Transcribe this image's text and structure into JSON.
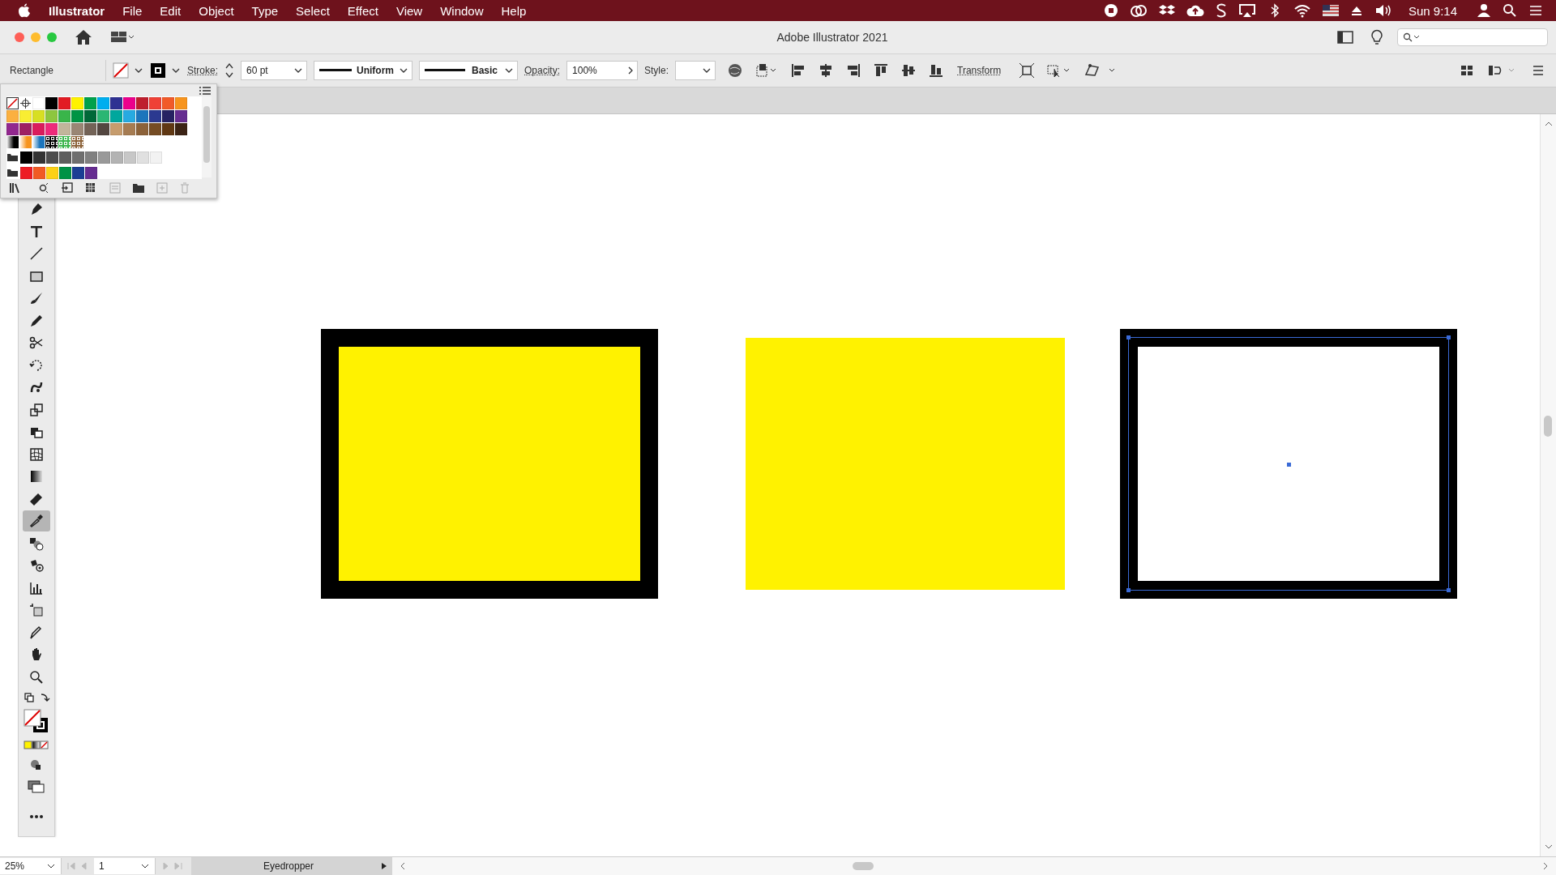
{
  "menu_bar": {
    "app_name": "Illustrator",
    "menus": [
      "File",
      "Edit",
      "Object",
      "Type",
      "Select",
      "Effect",
      "View",
      "Window",
      "Help"
    ],
    "clock": "Sun 9:14"
  },
  "window": {
    "title": "Adobe Illustrator 2021"
  },
  "control_bar": {
    "selection_label": "Rectangle",
    "stroke_label": "Stroke:",
    "stroke_weight": "60 pt",
    "stroke_profile": "Uniform",
    "brush": "Basic",
    "opacity_label": "Opacity:",
    "opacity": "100%",
    "style_label": "Style:",
    "transform": "Transform"
  },
  "swatches_panel": {
    "rows": [
      {
        "folder": false,
        "swatches": [
          {
            "kind": "none"
          },
          {
            "kind": "registration"
          },
          {
            "kind": "color",
            "color": "#ffffff"
          },
          {
            "kind": "color",
            "color": "#000000"
          },
          {
            "kind": "color",
            "color": "#e21b23"
          },
          {
            "kind": "color",
            "color": "#fff200"
          },
          {
            "kind": "color",
            "color": "#00a14b"
          },
          {
            "kind": "color",
            "color": "#00aeef"
          },
          {
            "kind": "color",
            "color": "#2e3192"
          },
          {
            "kind": "color",
            "color": "#ec008c"
          },
          {
            "kind": "color",
            "color": "#be1e2d"
          },
          {
            "kind": "color",
            "color": "#ef4136"
          },
          {
            "kind": "color",
            "color": "#f15a29"
          },
          {
            "kind": "color",
            "color": "#f7941d"
          }
        ]
      },
      {
        "folder": false,
        "swatches": [
          {
            "kind": "color",
            "color": "#fbb040"
          },
          {
            "kind": "color",
            "color": "#f9ed32"
          },
          {
            "kind": "color",
            "color": "#d7df23"
          },
          {
            "kind": "color",
            "color": "#8dc63f"
          },
          {
            "kind": "color",
            "color": "#39b54a"
          },
          {
            "kind": "color",
            "color": "#009444"
          },
          {
            "kind": "color",
            "color": "#006838"
          },
          {
            "kind": "color",
            "color": "#2bb673"
          },
          {
            "kind": "color",
            "color": "#00a79d"
          },
          {
            "kind": "color",
            "color": "#27aae1"
          },
          {
            "kind": "color",
            "color": "#1c75bc"
          },
          {
            "kind": "color",
            "color": "#2b3990"
          },
          {
            "kind": "color",
            "color": "#262262"
          },
          {
            "kind": "color",
            "color": "#662d91"
          }
        ]
      },
      {
        "folder": false,
        "swatches": [
          {
            "kind": "color",
            "color": "#92278f"
          },
          {
            "kind": "color",
            "color": "#9e1f63"
          },
          {
            "kind": "color",
            "color": "#da1c5c"
          },
          {
            "kind": "color",
            "color": "#ee2a7b"
          },
          {
            "kind": "color",
            "color": "#c2b59b"
          },
          {
            "kind": "color",
            "color": "#998675"
          },
          {
            "kind": "color",
            "color": "#736357"
          },
          {
            "kind": "color",
            "color": "#534741"
          },
          {
            "kind": "color",
            "color": "#c69c6d"
          },
          {
            "kind": "color",
            "color": "#a67c52"
          },
          {
            "kind": "color",
            "color": "#8c6239"
          },
          {
            "kind": "color",
            "color": "#754c24"
          },
          {
            "kind": "color",
            "color": "#603813"
          },
          {
            "kind": "color",
            "color": "#3c2415"
          }
        ]
      },
      {
        "folder": false,
        "swatches": [
          {
            "kind": "gradient",
            "color": "#000000"
          },
          {
            "kind": "gradient",
            "color": "#f7941d"
          },
          {
            "kind": "gradient",
            "color": "#1c75bc"
          },
          {
            "kind": "pattern",
            "color": "#000000"
          },
          {
            "kind": "pattern",
            "color": "#39b54a"
          },
          {
            "kind": "pattern",
            "color": "#8c6239"
          }
        ]
      },
      {
        "folder": true,
        "swatches": [
          {
            "kind": "color",
            "color": "#000000"
          },
          {
            "kind": "color",
            "color": "#333333"
          },
          {
            "kind": "color",
            "color": "#4d4d4d"
          },
          {
            "kind": "color",
            "color": "#5e5e5e"
          },
          {
            "kind": "color",
            "color": "#6f6f6f"
          },
          {
            "kind": "color",
            "color": "#808080"
          },
          {
            "kind": "color",
            "color": "#999999"
          },
          {
            "kind": "color",
            "color": "#b3b3b3"
          },
          {
            "kind": "color",
            "color": "#c7c7c7"
          },
          {
            "kind": "color",
            "color": "#e0e0e0"
          },
          {
            "kind": "color",
            "color": "#f2f2f2"
          }
        ]
      },
      {
        "folder": true,
        "swatches": [
          {
            "kind": "color",
            "color": "#ed1c24"
          },
          {
            "kind": "color",
            "color": "#f15a24"
          },
          {
            "kind": "color",
            "color": "#fcd116"
          },
          {
            "kind": "color",
            "color": "#009245"
          },
          {
            "kind": "color",
            "color": "#1b3f94"
          },
          {
            "kind": "color",
            "color": "#662d91"
          }
        ]
      }
    ]
  },
  "tools": [
    {
      "selected": false
    },
    {
      "selected": false
    },
    {
      "selected": false
    },
    {
      "selected": false
    },
    {
      "selected": false
    },
    {
      "selected": false
    },
    {
      "selected": false
    },
    {
      "selected": false
    },
    {
      "selected": false
    },
    {
      "selected": false
    },
    {
      "selected": false
    },
    {
      "selected": false
    },
    {
      "selected": false
    },
    {
      "selected": false
    },
    {
      "selected": true
    },
    {
      "selected": false
    },
    {
      "selected": false
    },
    {
      "selected": false
    },
    {
      "selected": false
    },
    {
      "selected": false
    },
    {
      "selected": false
    },
    {
      "selected": false
    }
  ],
  "artboard": {
    "shapes": [
      {
        "kind": "framed",
        "selected": false
      },
      {
        "kind": "plain",
        "selected": false
      },
      {
        "kind": "outline",
        "selected": true
      }
    ]
  },
  "status_bar": {
    "zoom": "25%",
    "artboard_number": "1",
    "current_tool": "Eyedropper"
  }
}
